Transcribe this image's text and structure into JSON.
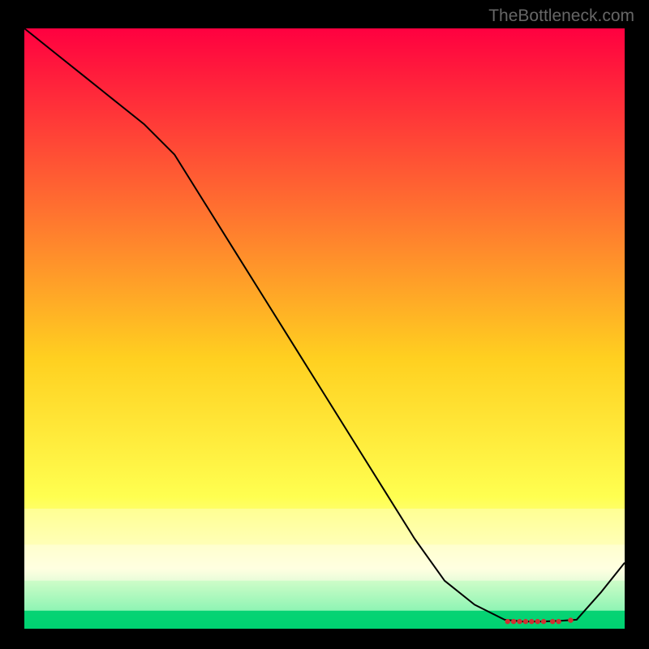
{
  "watermark": "TheBottleneck.com",
  "chart_data": {
    "type": "line",
    "title": "",
    "xlabel": "",
    "ylabel": "",
    "x_range": [
      0,
      100
    ],
    "y_range": [
      0,
      100
    ],
    "background_gradient": {
      "top": "#FF0040",
      "mid1": "#FF7030",
      "mid2": "#FFD020",
      "mid3": "#FFFF50",
      "mid4": "#FFFFD0",
      "bottom": "#00E080"
    },
    "overlay_bands": [
      {
        "from_y": 14,
        "to_y": 20,
        "tint": "#FFFFCC",
        "alpha": 0.45
      },
      {
        "from_y": 8,
        "to_y": 14,
        "tint": "#FFFFEE",
        "alpha": 0.55
      },
      {
        "from_y": 3,
        "to_y": 8,
        "tint": "#D0FFD0",
        "alpha": 0.5
      },
      {
        "from_y": 0,
        "to_y": 3,
        "tint": "#00D070",
        "alpha": 0.9
      }
    ],
    "series": [
      {
        "name": "curve",
        "color": "#000000",
        "stroke_width": 2,
        "x": [
          0,
          5,
          10,
          15,
          20,
          25,
          30,
          35,
          40,
          45,
          50,
          55,
          60,
          65,
          70,
          75,
          80,
          83,
          86,
          89,
          92,
          96,
          100
        ],
        "values": [
          100,
          96,
          92,
          88,
          84,
          79,
          71,
          63,
          55,
          47,
          39,
          31,
          23,
          15,
          8,
          4,
          1.5,
          1.2,
          1.2,
          1.3,
          1.5,
          6,
          11
        ]
      }
    ],
    "markers": {
      "color": "#D03030",
      "radius": 3.2,
      "points": [
        {
          "x": 80.5,
          "y": 1.2
        },
        {
          "x": 81.5,
          "y": 1.2
        },
        {
          "x": 82.5,
          "y": 1.2
        },
        {
          "x": 83.5,
          "y": 1.2
        },
        {
          "x": 84.5,
          "y": 1.2
        },
        {
          "x": 85.5,
          "y": 1.2
        },
        {
          "x": 86.5,
          "y": 1.2
        },
        {
          "x": 88.0,
          "y": 1.2
        },
        {
          "x": 89.0,
          "y": 1.2
        },
        {
          "x": 91.0,
          "y": 1.4
        }
      ]
    }
  }
}
